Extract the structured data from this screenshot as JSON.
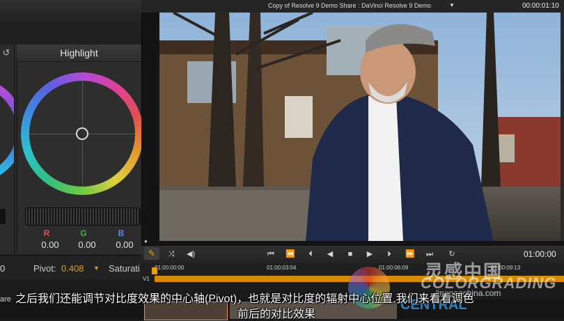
{
  "viewer": {
    "title": "Copy of Resolve 9 Demo Share : DaVinci Resolve 9 Demo",
    "title_caret": "▼",
    "timecode_top": "00:00:01:10",
    "transport_timecode": "01:00:00"
  },
  "color_panel": {
    "highlight_title": "Highlight",
    "reset_glyph": "↺",
    "channels": [
      {
        "label": "R",
        "value": "0.00",
        "color": "#e05050"
      },
      {
        "label": "G",
        "value": "0.00",
        "color": "#4caf50"
      },
      {
        "label": "B",
        "value": "0.00",
        "color": "#5a8de0"
      }
    ],
    "left_value": "0",
    "pivot_label": "Pivot:",
    "pivot_value": "0.408",
    "pivot_caret": "▼",
    "saturation_label": "Saturati",
    "share_label": "are"
  },
  "timeline": {
    "ruler_timecodes": [
      "01:00:00:00",
      "01:00:03:04",
      "01:00:06:09",
      "01:00:09:13"
    ],
    "track_label": "V1"
  },
  "transport": {
    "icons": [
      "pencil-icon",
      "shuffle-icon",
      "speaker-icon",
      "jump-start-icon",
      "rewind-icon",
      "step-back-icon",
      "play-reverse-icon",
      "stop-icon",
      "play-icon",
      "step-forward-icon",
      "fast-forward-icon",
      "loop-icon"
    ]
  },
  "watermark": {
    "cn_text": "灵感中国",
    "sub_text": "COLORGRADING",
    "url": "lingganchina.com",
    "central": "CENTRAL"
  },
  "subtitles": {
    "line1": "之后我们还能调节对比度效果的中心轴(Pivot)，也就是对比度的辐射中心位置.我们来看看调色",
    "line2": "前后的对比效果"
  },
  "colors": {
    "accent": "#e8a000",
    "panel_bg": "#2c2c2c"
  }
}
